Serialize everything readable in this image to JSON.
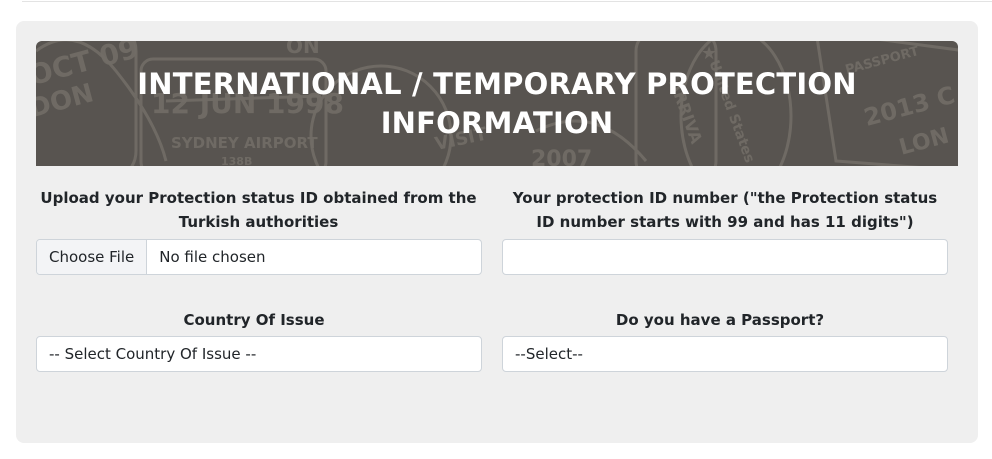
{
  "banner": {
    "title": "INTERNATIONAL / TEMPORARY PROTECTION INFORMATION"
  },
  "upload": {
    "label": "Upload your Protection status ID obtained from the Turkish authorities",
    "button_label": "Choose File",
    "status_text": "No file chosen"
  },
  "protection_id": {
    "label": "Your protection ID number (\"the Protection status ID number starts with 99 and has 11 digits\")",
    "value": ""
  },
  "country": {
    "label": "Country Of Issue",
    "selected": "-- Select Country Of Issue --"
  },
  "passport": {
    "label": "Do you have a Passport?",
    "selected": "--Select--"
  }
}
